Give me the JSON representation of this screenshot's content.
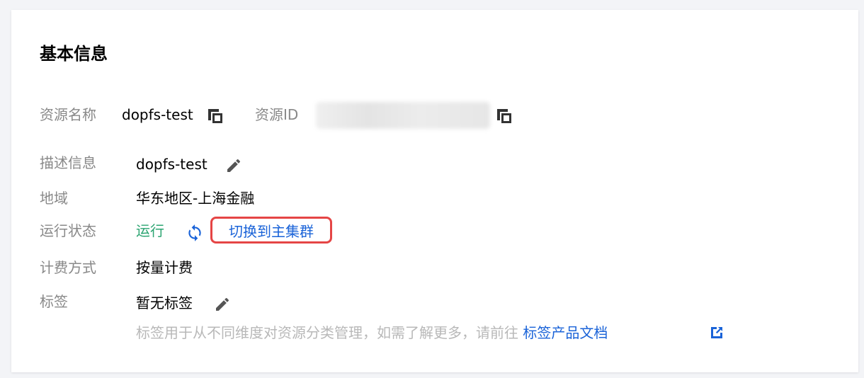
{
  "section": {
    "title": "基本信息"
  },
  "resource": {
    "name_label": "资源名称",
    "name_value": "dopfs-test",
    "id_label": "资源ID"
  },
  "fields": {
    "description_label": "描述信息",
    "description_value": "dopfs-test",
    "region_label": "地域",
    "region_value": "华东地区-上海金融",
    "status_label": "运行状态",
    "status_value": "运行",
    "switch_label": "切换到主集群",
    "billing_label": "计费方式",
    "billing_value": "按量计费",
    "tags_label": "标签",
    "tags_value": "暂无标签",
    "tags_hint": "标签用于从不同维度对资源分类管理，如需了解更多，请前往",
    "tags_link": "标签产品文档"
  },
  "colors": {
    "status_green": "#2ba471",
    "link_blue": "#1a63d8",
    "highlight_red": "#e54545",
    "muted_label": "#888888"
  },
  "icons": [
    "copy-icon",
    "edit-icon",
    "refresh-icon",
    "external-link-icon"
  ]
}
